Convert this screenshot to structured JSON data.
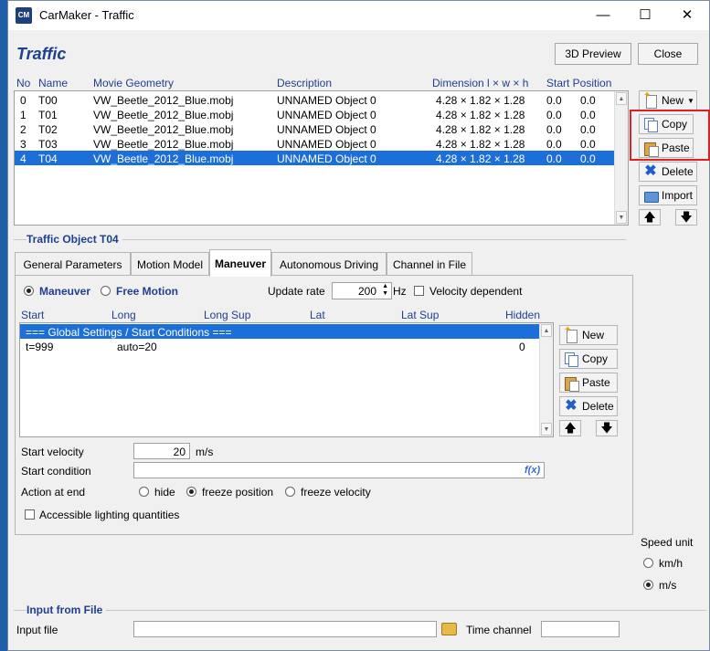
{
  "window": {
    "title": "CarMaker - Traffic",
    "icon_text": "CM",
    "minimize": "—",
    "maximize": "☐",
    "close": "✕"
  },
  "header": {
    "title": "Traffic",
    "preview_label": "3D Preview",
    "close_label": "Close"
  },
  "object_list": {
    "columns": [
      "No",
      "Name",
      "Movie Geometry",
      "Description",
      "Dimension l × w × h",
      "Start Position"
    ],
    "rows": [
      {
        "no": "0",
        "name": "T00",
        "geometry": "VW_Beetle_2012_Blue.mobj",
        "description": "UNNAMED Object 0",
        "dimension": "4.28 × 1.82 × 1.28",
        "pos_a": "0.0",
        "pos_b": "0.0"
      },
      {
        "no": "1",
        "name": "T01",
        "geometry": "VW_Beetle_2012_Blue.mobj",
        "description": "UNNAMED Object 0",
        "dimension": "4.28 × 1.82 × 1.28",
        "pos_a": "0.0",
        "pos_b": "0.0"
      },
      {
        "no": "2",
        "name": "T02",
        "geometry": "VW_Beetle_2012_Blue.mobj",
        "description": "UNNAMED Object 0",
        "dimension": "4.28 × 1.82 × 1.28",
        "pos_a": "0.0",
        "pos_b": "0.0"
      },
      {
        "no": "3",
        "name": "T03",
        "geometry": "VW_Beetle_2012_Blue.mobj",
        "description": "UNNAMED Object 0",
        "dimension": "4.28 × 1.82 × 1.28",
        "pos_a": "0.0",
        "pos_b": "0.0"
      },
      {
        "no": "4",
        "name": "T04",
        "geometry": "VW_Beetle_2012_Blue.mobj",
        "description": "UNNAMED Object 0",
        "dimension": "4.28 × 1.82 × 1.28",
        "pos_a": "0.0",
        "pos_b": "0.0"
      }
    ],
    "selected_index": 4
  },
  "object_buttons": {
    "new": "New",
    "copy": "Copy",
    "paste": "Paste",
    "delete": "Delete",
    "import": "Import"
  },
  "traffic_object": {
    "title": "Traffic Object T04",
    "tabs": [
      "General Parameters",
      "Motion Model",
      "Maneuver",
      "Autonomous Driving",
      "Channel in File"
    ],
    "active_tab": "Maneuver"
  },
  "maneuver": {
    "mode_maneuver": "Maneuver",
    "mode_free": "Free Motion",
    "update_rate_label": "Update rate",
    "update_rate_value": "200",
    "update_rate_unit": "Hz",
    "velocity_dependent": "Velocity dependent",
    "columns": [
      "Start",
      "Long",
      "Long Sup",
      "Lat",
      "Lat Sup",
      "Hidden"
    ],
    "rows": [
      {
        "text": "=== Global Settings / Start Conditions ==="
      },
      {
        "start": "t=999",
        "long": "auto=20",
        "hidden": "0"
      }
    ],
    "buttons": {
      "new": "New",
      "copy": "Copy",
      "paste": "Paste",
      "delete": "Delete"
    },
    "start_velocity_label": "Start velocity",
    "start_velocity_value": "20",
    "start_velocity_unit": "m/s",
    "start_condition_label": "Start condition",
    "start_condition_value": "",
    "fx": "f(x)",
    "action_label": "Action at end",
    "action_hide": "hide",
    "action_freeze_position": "freeze position",
    "action_freeze_velocity": "freeze velocity",
    "lighting": "Accessible lighting quantities"
  },
  "speed_unit": {
    "label": "Speed unit",
    "kmh": "km/h",
    "ms": "m/s",
    "selected": "m/s"
  },
  "input_file": {
    "title": "Input from File",
    "input_label": "Input file",
    "input_value": "",
    "time_channel_label": "Time channel",
    "time_channel_value": ""
  },
  "colors": {
    "accent": "#1f3f8f",
    "selection": "#1c6fd9",
    "highlight": "#e02020"
  }
}
